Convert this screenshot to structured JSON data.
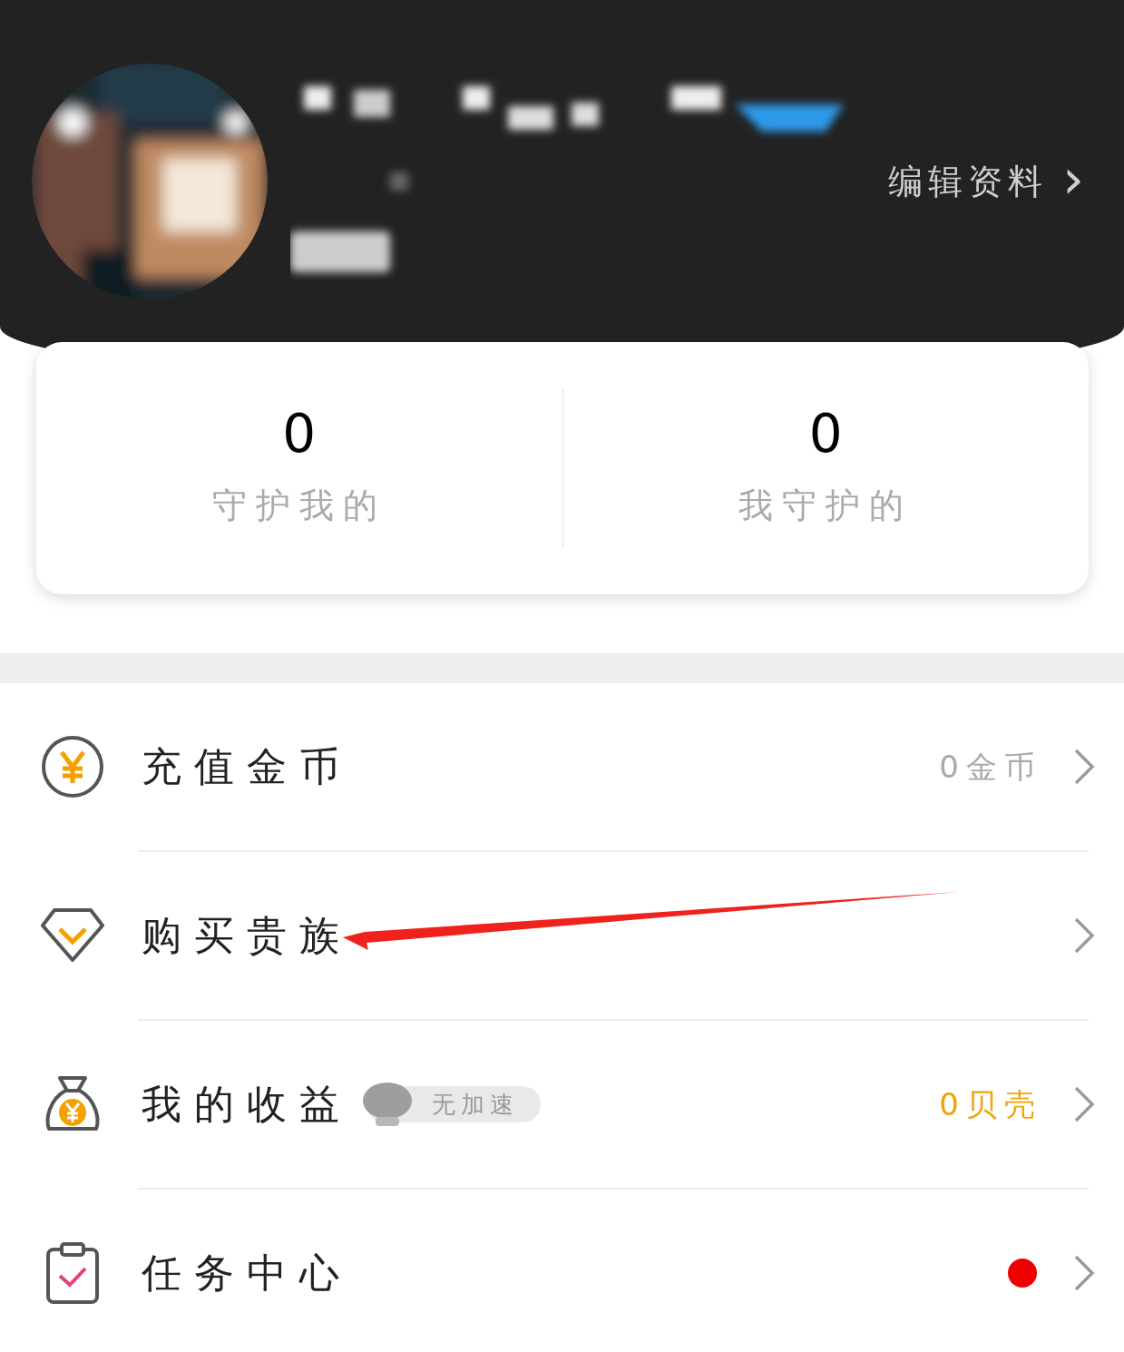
{
  "profile": {
    "edit_label": "编辑资料",
    "edit_chevron": "›"
  },
  "stats": [
    {
      "value": "0",
      "label": "守护我的"
    },
    {
      "value": "0",
      "label": "我守护的"
    }
  ],
  "menu": [
    {
      "kind": "coin",
      "label": "充值金币",
      "value": "0金币",
      "highlight": false,
      "badge": false
    },
    {
      "kind": "diamond",
      "label": "购买贵族",
      "badge": false,
      "annotated": true
    },
    {
      "kind": "bag",
      "label": "我的收益",
      "tag": "无加速",
      "value": "0贝壳",
      "highlight": true,
      "badge": false
    },
    {
      "kind": "clipboard",
      "label": "任务中心",
      "badge": true
    }
  ]
}
